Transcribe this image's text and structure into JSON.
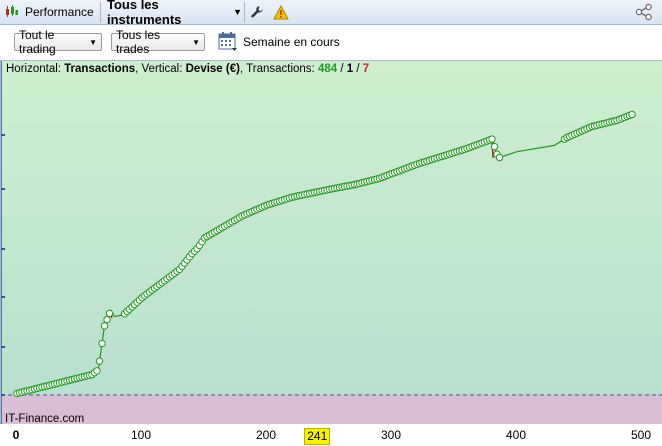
{
  "header": {
    "performance_label": "Performance",
    "instruments_label": "Tous les instruments",
    "icons": [
      "chart-icon",
      "wrench-icon",
      "warning-icon",
      "share-icon"
    ]
  },
  "toolbar": {
    "filter_trading": "Tout le trading",
    "filter_trades": "Tous les trades",
    "period_label": "Semaine en cours"
  },
  "legend": {
    "horizontal_prefix": "Horizontal: ",
    "horizontal_value": "Transactions",
    "vertical_prefix": ", Vertical: ",
    "vertical_value": "Devise (€)",
    "transactions_prefix": ", Transactions: ",
    "total": "484",
    "sep1": " / ",
    "ones": "1",
    "sep2": " / ",
    "losers": "7"
  },
  "brand": "IT-Finance.com",
  "x_axis": {
    "ticks": [
      "0",
      "100",
      "200",
      "300",
      "400",
      "500"
    ],
    "cursor": "241"
  },
  "colors": {
    "curve": "#1f9a1f",
    "loss": "#c0282a",
    "gain_area_top": "#cfeecf",
    "gain_area_bottom": "#b9e0cf",
    "loss_area": "#d8bfd6",
    "marker": "#f5f300"
  },
  "chart_data": {
    "type": "line",
    "x_label": "Transactions",
    "y_label": "Devise (€)",
    "xlim": [
      0,
      500
    ],
    "ylim": [
      0,
      10
    ],
    "y_zero": 0,
    "points": [
      [
        0,
        0.05
      ],
      [
        20,
        0.25
      ],
      [
        40,
        0.45
      ],
      [
        60,
        0.65
      ],
      [
        65,
        0.8
      ],
      [
        70,
        2.2
      ],
      [
        75,
        2.7
      ],
      [
        78,
        2.5
      ],
      [
        85,
        2.55
      ],
      [
        100,
        3.1
      ],
      [
        120,
        3.7
      ],
      [
        130,
        4.0
      ],
      [
        140,
        4.5
      ],
      [
        145,
        4.7
      ],
      [
        150,
        5.0
      ],
      [
        165,
        5.35
      ],
      [
        180,
        5.7
      ],
      [
        200,
        6.05
      ],
      [
        220,
        6.3
      ],
      [
        250,
        6.55
      ],
      [
        270,
        6.7
      ],
      [
        290,
        6.9
      ],
      [
        300,
        7.05
      ],
      [
        320,
        7.35
      ],
      [
        340,
        7.6
      ],
      [
        360,
        7.85
      ],
      [
        380,
        8.15
      ],
      [
        385,
        7.55
      ],
      [
        400,
        7.75
      ],
      [
        430,
        7.95
      ],
      [
        440,
        8.2
      ],
      [
        460,
        8.55
      ],
      [
        480,
        8.75
      ],
      [
        493,
        8.95
      ]
    ],
    "losing_trades": [
      [
        75,
        2.7,
        2.45
      ],
      [
        380,
        8.15,
        7.55
      ]
    ],
    "cursor_x": 241
  }
}
